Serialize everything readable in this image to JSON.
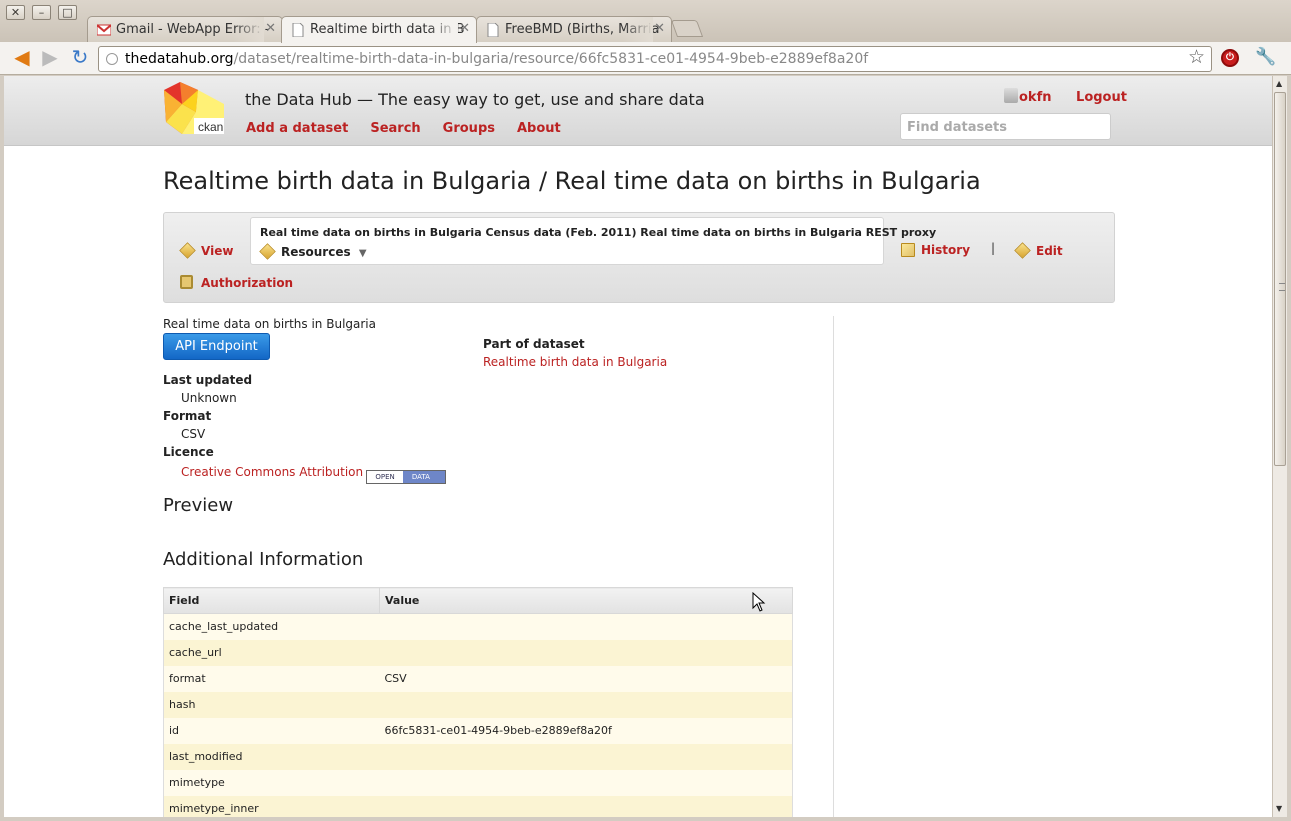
{
  "browser": {
    "tabs": [
      {
        "title": "Gmail - WebApp Error: -",
        "icon": "gmail-icon"
      },
      {
        "title": "Realtime birth data in B",
        "icon": "page-icon"
      },
      {
        "title": "FreeBMD (Births, Marria",
        "icon": "page-icon"
      }
    ],
    "url_host": "thedatahub.org",
    "url_path": "/dataset/realtime-birth-data-in-bulgaria/resource/66fc5831-ce01-4954-9beb-e2889ef8a20f"
  },
  "site": {
    "logo_text": "ckan",
    "title": "the Data Hub — The easy way to get, use and share data",
    "nav": [
      "Add a dataset",
      "Search",
      "Groups",
      "About"
    ],
    "user": "okfn",
    "logout": "Logout",
    "search_placeholder": "Find datasets"
  },
  "page": {
    "title": "Realtime birth data in Bulgaria / Real time data on births in Bulgaria"
  },
  "actions": {
    "view": "View",
    "resources_links": "Real time data on births in Bulgaria Census data (Feb. 2011) Real time data on births in Bulgaria REST proxy",
    "resources_label": "Resources",
    "history": "History",
    "separator": "|",
    "edit": "Edit",
    "authorization": "Authorization"
  },
  "resource": {
    "description": "Real time data on births in Bulgaria",
    "api_button": "API Endpoint",
    "last_updated_label": "Last updated",
    "last_updated": "Unknown",
    "format_label": "Format",
    "format": "CSV",
    "licence_label": "Licence",
    "licence": "Creative Commons Attribution",
    "badge_left": "OPEN",
    "badge_right": "DATA",
    "part_of_label": "Part of dataset",
    "part_of": "Realtime birth data in Bulgaria"
  },
  "sections": {
    "preview": "Preview",
    "additional": "Additional Information"
  },
  "table": {
    "headers": [
      "Field",
      "Value"
    ],
    "rows": [
      [
        "cache_last_updated",
        ""
      ],
      [
        "cache_url",
        ""
      ],
      [
        "format",
        "CSV"
      ],
      [
        "hash",
        ""
      ],
      [
        "id",
        "66fc5831-ce01-4954-9beb-e2889ef8a20f"
      ],
      [
        "last_modified",
        ""
      ],
      [
        "mimetype",
        ""
      ],
      [
        "mimetype_inner",
        ""
      ]
    ]
  },
  "colors": {
    "link": "#bb2222",
    "api_button": "#1f7fd8",
    "row_odd": "#fffbeb",
    "row_even": "#fbf4d3"
  }
}
